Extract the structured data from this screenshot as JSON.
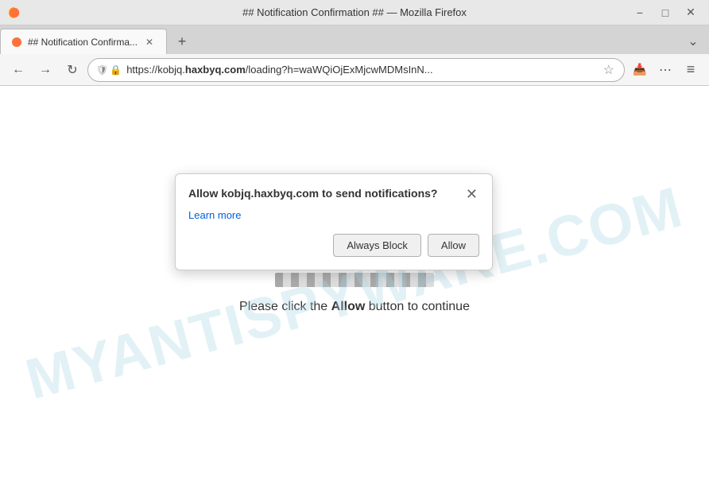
{
  "window": {
    "title": "## Notification Confirmation ## — Mozilla Firefox",
    "minimize_label": "−",
    "maximize_label": "□",
    "close_label": "✕"
  },
  "tab": {
    "title": "## Notification Confirma...",
    "close_label": "✕"
  },
  "new_tab": {
    "label": "+"
  },
  "nav": {
    "back_label": "←",
    "forward_label": "→",
    "reload_label": "↻",
    "url_prefix": "https://kobjq.",
    "url_domain": "haxbyq.com",
    "url_suffix": "/loading?h=waWQiOjExMjcwMDMsInN...",
    "star_label": "☆",
    "extensions_label": "⋯",
    "menu_label": "≡"
  },
  "popup": {
    "title": "Allow kobjq.haxbyq.com to send notifications?",
    "learn_more": "Learn more",
    "always_block_label": "Always Block",
    "allow_label": "Allow",
    "close_label": "✕"
  },
  "page": {
    "message_before": "Please click the ",
    "message_bold": "Allow",
    "message_after": " button to continue"
  },
  "watermark": {
    "text": "MYANTISPYWARE.COM"
  }
}
